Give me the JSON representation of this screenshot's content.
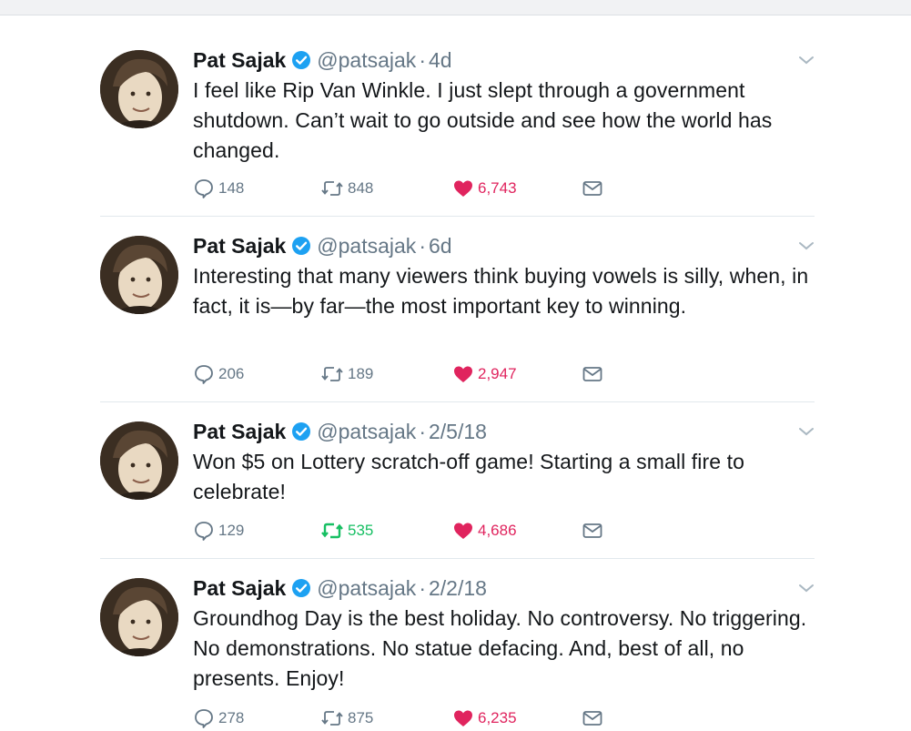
{
  "colors": {
    "like": "#e0245e",
    "retweet_active": "#17bf63",
    "verified": "#1da1f2",
    "muted": "#657786"
  },
  "tweets": [
    {
      "name": "Pat Sajak",
      "handle": "@patsajak",
      "dot": "·",
      "time": "4d",
      "text": "I feel like Rip Van Winkle. I just slept through a government shutdown. Can’t wait to go outside and see how the world has changed.",
      "replies": "148",
      "retweets": "848",
      "likes": "6,743",
      "retweeted": false
    },
    {
      "name": "Pat Sajak",
      "handle": "@patsajak",
      "dot": "·",
      "time": "6d",
      "text": "Interesting that many viewers think buying vowels is silly, when, in fact, it is—by far—the most important key to winning.",
      "replies": "206",
      "retweets": "189",
      "likes": "2,947",
      "retweeted": false
    },
    {
      "name": "Pat Sajak",
      "handle": "@patsajak",
      "dot": "·",
      "time": "2/5/18",
      "text": "Won $5 on Lottery scratch-off game! Starting a small fire to celebrate!",
      "replies": "129",
      "retweets": "535",
      "likes": "4,686",
      "retweeted": true
    },
    {
      "name": "Pat Sajak",
      "handle": "@patsajak",
      "dot": "·",
      "time": "2/2/18",
      "text": "Groundhog Day is the best holiday. No controversy.  No triggering. No demonstrations. No statue defacing. And, best of all, no presents. Enjoy!",
      "replies": "278",
      "retweets": "875",
      "likes": "6,235",
      "retweeted": false
    }
  ]
}
